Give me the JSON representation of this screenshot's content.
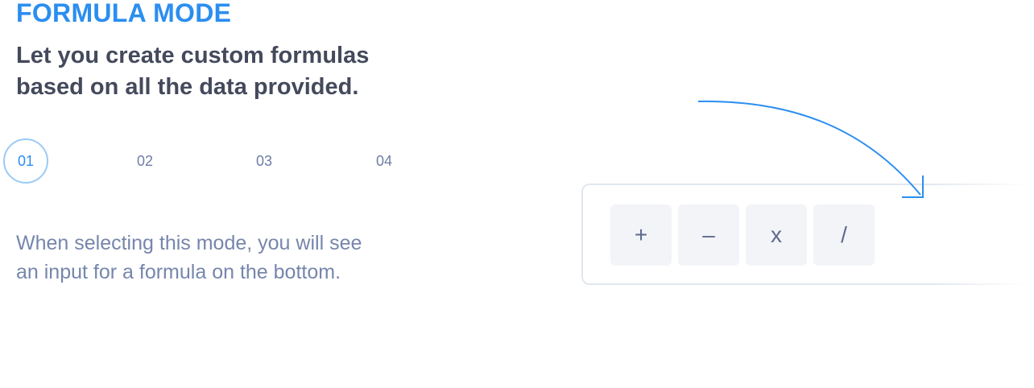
{
  "title": "FORMULA MODE",
  "headline": {
    "line1": "Let you create custom formulas",
    "line2": "based on all the data provided."
  },
  "steps": [
    {
      "label": "01",
      "active": true
    },
    {
      "label": "02",
      "active": false
    },
    {
      "label": "03",
      "active": false
    },
    {
      "label": "04",
      "active": false
    }
  ],
  "description": {
    "line1": "When selecting this mode, you will see",
    "line2": "an input for a formula on the bottom."
  },
  "operators": {
    "plus": "+",
    "minus": "–",
    "multiply": "x",
    "divide": "/"
  },
  "colors": {
    "accent": "#2b8ef0",
    "heading": "#444a5c",
    "muted": "#7686ab",
    "button_bg": "#f2f4f8"
  }
}
